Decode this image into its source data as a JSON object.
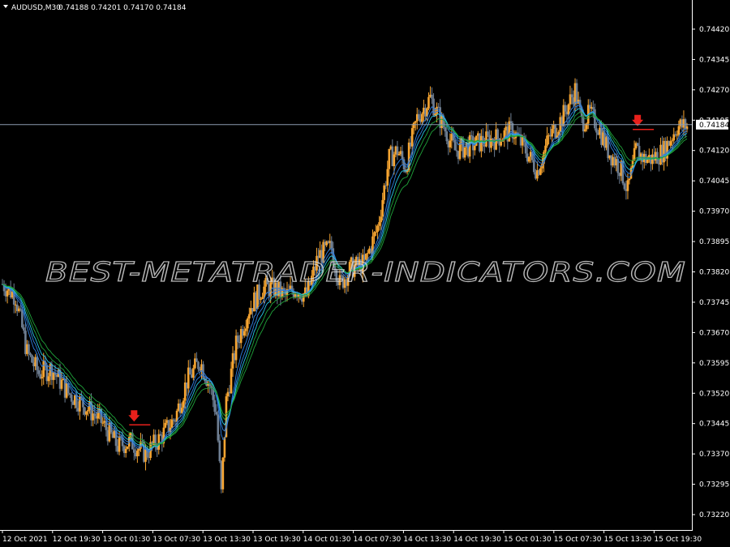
{
  "header": {
    "symbol": "AUDUSD,M30",
    "ohlc": "0.74188 0.74201 0.74170 0.74184"
  },
  "watermark": "BEST-METATRADER-INDICATORS.COM",
  "price_label": "0.74184",
  "colors": {
    "background": "#000000",
    "bull_candle": "#f7a531",
    "bear_candle": "#6f7f93",
    "blue_ribbon": "#2f7fe0",
    "cyan_line": "#27c7e8",
    "green_ribbon": "#1fa23a",
    "signal_arrow": "#e8201b",
    "price_line": "#8a9bb0"
  },
  "chart_data": {
    "type": "candlestick",
    "symbol": "AUDUSD",
    "timeframe": "M30",
    "ylim": [
      0.7319,
      0.7446
    ],
    "current_price": 0.74184,
    "y_ticks": [
      "0.74420",
      "0.74345",
      "0.74270",
      "0.74195",
      "0.74120",
      "0.74045",
      "0.73970",
      "0.73895",
      "0.73820",
      "0.73745",
      "0.73670",
      "0.73595",
      "0.73520",
      "0.73445",
      "0.73370",
      "0.73295",
      "0.73220"
    ],
    "x_ticks": [
      "12 Oct 2021",
      "12 Oct 19:30",
      "13 Oct 01:30",
      "13 Oct 07:30",
      "13 Oct 13:30",
      "13 Oct 19:30",
      "14 Oct 01:30",
      "14 Oct 07:30",
      "14 Oct 13:30",
      "14 Oct 19:30",
      "15 Oct 01:30",
      "15 Oct 07:30",
      "15 Oct 13:30",
      "15 Oct 19:30"
    ],
    "price_path": [
      [
        0,
        0.7379
      ],
      [
        8,
        0.7376
      ],
      [
        15,
        0.7362
      ],
      [
        22,
        0.7357
      ],
      [
        30,
        0.7358
      ],
      [
        40,
        0.7352
      ],
      [
        50,
        0.7349
      ],
      [
        60,
        0.7345
      ],
      [
        70,
        0.7339
      ],
      [
        78,
        0.734
      ],
      [
        87,
        0.7337
      ],
      [
        96,
        0.7341
      ],
      [
        105,
        0.7346
      ],
      [
        112,
        0.7355
      ],
      [
        120,
        0.736
      ],
      [
        126,
        0.7354
      ],
      [
        130,
        0.7347
      ],
      [
        133,
        0.7327
      ],
      [
        136,
        0.735
      ],
      [
        142,
        0.7364
      ],
      [
        150,
        0.7373
      ],
      [
        158,
        0.7378
      ],
      [
        165,
        0.7378
      ],
      [
        172,
        0.7376
      ],
      [
        178,
        0.7378
      ],
      [
        185,
        0.7376
      ],
      [
        192,
        0.7386
      ],
      [
        200,
        0.7388
      ],
      [
        205,
        0.7379
      ],
      [
        212,
        0.7383
      ],
      [
        220,
        0.7384
      ],
      [
        228,
        0.7393
      ],
      [
        235,
        0.741
      ],
      [
        240,
        0.7412
      ],
      [
        245,
        0.7408
      ],
      [
        252,
        0.742
      ],
      [
        260,
        0.7425
      ],
      [
        268,
        0.7418
      ],
      [
        275,
        0.7412
      ],
      [
        283,
        0.7413
      ],
      [
        290,
        0.7414
      ],
      [
        300,
        0.7415
      ],
      [
        310,
        0.7417
      ],
      [
        318,
        0.7412
      ],
      [
        325,
        0.7407
      ],
      [
        332,
        0.7415
      ],
      [
        340,
        0.742
      ],
      [
        348,
        0.7427
      ],
      [
        352,
        0.7419
      ],
      [
        357,
        0.7421
      ],
      [
        362,
        0.7418
      ],
      [
        368,
        0.7412
      ],
      [
        375,
        0.7408
      ],
      [
        380,
        0.7402
      ],
      [
        385,
        0.7412
      ],
      [
        390,
        0.741
      ],
      [
        395,
        0.741
      ],
      [
        402,
        0.7412
      ],
      [
        410,
        0.7418
      ],
      [
        416,
        0.7418
      ]
    ],
    "indicator": "moving average ribbon (blue, cyan, green)",
    "signals": [
      {
        "type": "sell-arrow",
        "bar": 80,
        "price": 0.7345
      },
      {
        "type": "sell-arrow",
        "bar": 386,
        "price": 0.7418
      }
    ],
    "grid": false
  }
}
